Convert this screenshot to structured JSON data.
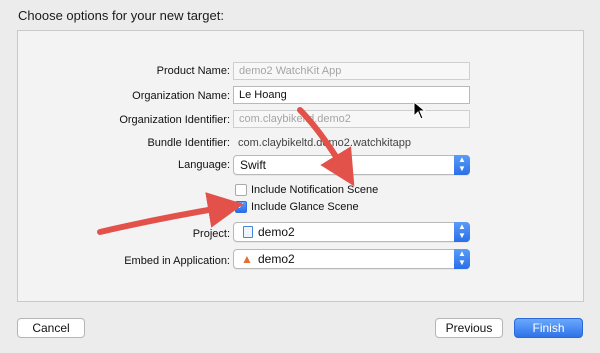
{
  "header": {
    "title": "Choose options for your new target:"
  },
  "form": {
    "product_name": {
      "label": "Product Name:",
      "value": "demo2 WatchKit App"
    },
    "organization_name": {
      "label": "Organization Name:",
      "value": "Le Hoang"
    },
    "organization_identifier": {
      "label": "Organization Identifier:",
      "value": "com.claybikeltd.demo2"
    },
    "bundle_identifier": {
      "label": "Bundle Identifier:",
      "value": "com.claybikeltd.demo2.watchkitapp"
    },
    "language": {
      "label": "Language:",
      "value": "Swift"
    },
    "include_notification_scene": {
      "label": "Include Notification Scene",
      "checked": false
    },
    "include_glance_scene": {
      "label": "Include Glance Scene",
      "checked": true
    },
    "project": {
      "label": "Project:",
      "value": "demo2"
    },
    "embed_in_application": {
      "label": "Embed in Application:",
      "value": "demo2"
    }
  },
  "buttons": {
    "cancel": "Cancel",
    "previous": "Previous",
    "finish": "Finish"
  },
  "icons": {
    "stepper": "up-down-stepper-icon",
    "checkmark": "checkmark-icon",
    "project": "project-document-icon",
    "application": "app-icon",
    "cursor": "mouse-pointer-icon",
    "annotation_arrow": "red-arrow-icon"
  },
  "colors": {
    "accent": "#2e73ea",
    "annotation": "#e2524a"
  }
}
